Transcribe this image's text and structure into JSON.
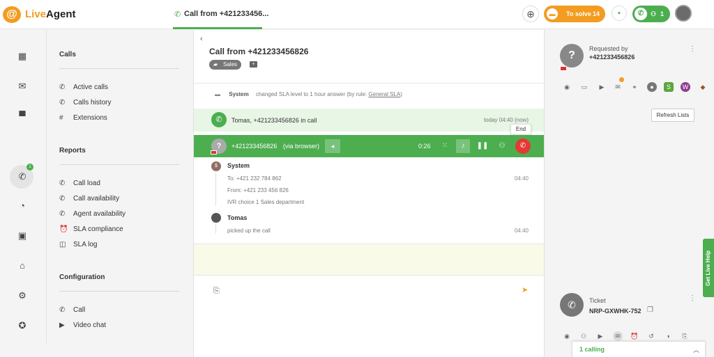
{
  "app": {
    "logo_mark": "@",
    "logo_word1": "Live",
    "logo_word2": "Agent"
  },
  "topbar": {
    "tab_label": "Call from +421233456...",
    "to_solve_label": "To solve",
    "to_solve_count": "14",
    "calls_count": "1"
  },
  "leftnav": {
    "calls_badge": "1"
  },
  "menu": {
    "calls_title": "Calls",
    "calls_items": [
      {
        "label": "Active calls",
        "icon": "phone-icon"
      },
      {
        "label": "Calls history",
        "icon": "phone-icon"
      },
      {
        "label": "Extensions",
        "icon": "hash-icon"
      }
    ],
    "reports_title": "Reports",
    "reports_items": [
      {
        "label": "Call load",
        "icon": "phone-icon"
      },
      {
        "label": "Call availability",
        "icon": "phone-icon"
      },
      {
        "label": "Agent availability",
        "icon": "phone-icon"
      },
      {
        "label": "SLA compliance",
        "icon": "alarm-icon"
      },
      {
        "label": "SLA log",
        "icon": "sla-log-icon"
      }
    ],
    "config_title": "Configuration",
    "config_items": [
      {
        "label": "Call",
        "icon": "phone-icon"
      },
      {
        "label": "Video chat",
        "icon": "video-icon"
      }
    ]
  },
  "ticket": {
    "title": "Call from +421233456826",
    "tag": "Sales",
    "system_event": {
      "name": "System",
      "text": "changed SLA level to 1 hour answer (by rule:",
      "link": "General SLA",
      "after": ")"
    },
    "in_call": {
      "text": "Tomas, +421233456826 in call",
      "time": "today 04:40 (now)"
    },
    "call_bar": {
      "number": "+421233456826",
      "via": "(via browser)",
      "duration": "0:26",
      "end_tooltip": "End"
    },
    "messages": [
      {
        "name": "System",
        "lines": [
          "To: +421 232 784 862",
          "From: +421 233 456 826",
          "IVR choice 1 Sales department"
        ],
        "time": "04:40"
      },
      {
        "name": "Tomas",
        "lines": [
          "picked up the call"
        ],
        "time": "04:40"
      }
    ]
  },
  "right": {
    "requested_by_label": "Requested by",
    "requested_by_number": "+421233456826",
    "refresh_label": "Refresh Lists",
    "ticket_label": "Ticket",
    "ticket_id": "NRP-GXWHK-752",
    "calling_text": "1 calling",
    "live_help": "Get Live Help"
  },
  "colors": {
    "accent_orange": "#f39c21",
    "accent_green": "#4cae4f",
    "end_red": "#e53935"
  }
}
